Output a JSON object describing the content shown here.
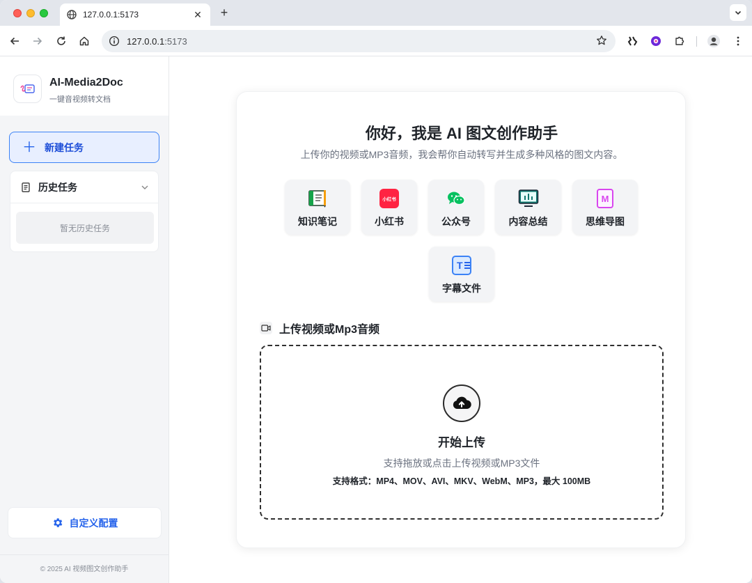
{
  "browser": {
    "tab_title": "127.0.0.1:5173",
    "url_host": "127.0.0.1",
    "url_port": ":5173"
  },
  "sidebar": {
    "app_name": "AI-Media2Doc",
    "app_tagline": "一键音视频转文档",
    "new_task_label": "新建任务",
    "history_label": "历史任务",
    "history_empty": "暂无历史任务",
    "custom_config_label": "自定义配置",
    "footer": "© 2025 AI 视频图文创作助手"
  },
  "main": {
    "greeting": "你好，我是 AI 图文创作助手",
    "subtitle": "上传你的视频或MP3音频，我会帮你自动转写并生成多种风格的图文内容。",
    "styles": [
      {
        "label": "知识笔记",
        "icon": "notebook-icon"
      },
      {
        "label": "小红书",
        "icon": "xiaohongshu-icon",
        "icon_text": "小红书"
      },
      {
        "label": "公众号",
        "icon": "wechat-icon"
      },
      {
        "label": "内容总结",
        "icon": "summary-monitor-icon"
      },
      {
        "label": "思维导图",
        "icon": "mindmap-icon",
        "icon_text": "M"
      },
      {
        "label": "字幕文件",
        "icon": "subtitle-icon",
        "icon_text": "T"
      }
    ],
    "upload_section_title": "上传视频或Mp3音频",
    "dropzone": {
      "title": "开始上传",
      "description": "支持拖放或点击上传视频或MP3文件",
      "formats": "支持格式：MP4、MOV、AVI、MKV、WebM、MP3，最大 100MB"
    }
  },
  "colors": {
    "accent": "#2563eb",
    "accent_bg": "#e8efff",
    "xiaohongshu": "#ff2442",
    "wechat": "#07c160",
    "mindmap": "#d946ef",
    "subtitle": "#3b82f6"
  }
}
